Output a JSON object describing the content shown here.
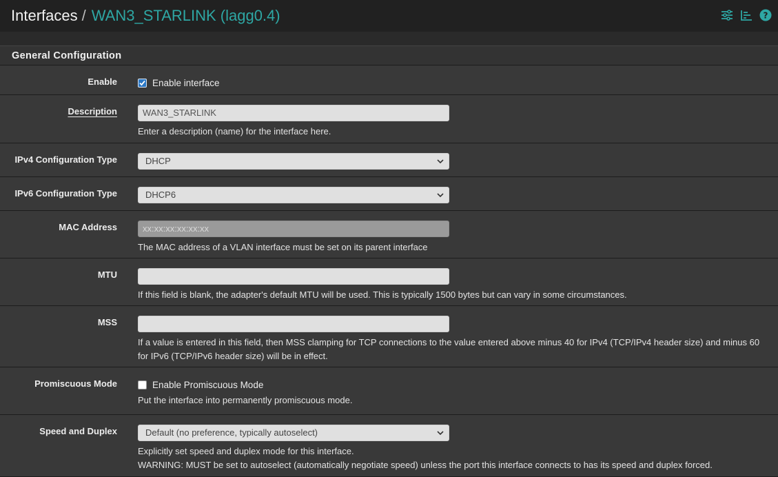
{
  "breadcrumb": {
    "root": "Interfaces",
    "separator": "/",
    "current": "WAN3_STARLINK (lagg0.4)"
  },
  "header_icons": [
    "sliders-icon",
    "list-chart-icon",
    "help-icon"
  ],
  "colors": {
    "accent": "#2ea7a4",
    "checkbox_on": "#2b78c5"
  },
  "panel": {
    "title": "General Configuration"
  },
  "fields": {
    "enable": {
      "label": "Enable",
      "checkbox_label": "Enable interface",
      "checked": true
    },
    "description": {
      "label": "Description",
      "value": "WAN3_STARLINK",
      "help": "Enter a description (name) for the interface here."
    },
    "ipv4": {
      "label": "IPv4 Configuration Type",
      "selected": "DHCP"
    },
    "ipv6": {
      "label": "IPv6 Configuration Type",
      "selected": "DHCP6"
    },
    "mac": {
      "label": "MAC Address",
      "placeholder": "xx:xx:xx:xx:xx:xx",
      "help": "The MAC address of a VLAN interface must be set on its parent interface"
    },
    "mtu": {
      "label": "MTU",
      "value": "",
      "help": "If this field is blank, the adapter's default MTU will be used. This is typically 1500 bytes but can vary in some circumstances."
    },
    "mss": {
      "label": "MSS",
      "value": "",
      "help": "If a value is entered in this field, then MSS clamping for TCP connections to the value entered above minus 40 for IPv4 (TCP/IPv4 header size) and minus 60 for IPv6 (TCP/IPv6 header size) will be in effect."
    },
    "promiscuous": {
      "label": "Promiscuous Mode",
      "checkbox_label": "Enable Promiscuous Mode",
      "checked": false,
      "help": "Put the interface into permanently promiscuous mode."
    },
    "speed": {
      "label": "Speed and Duplex",
      "selected": "Default (no preference, typically autoselect)",
      "help": "Explicitly set speed and duplex mode for this interface.",
      "warning": "WARNING: MUST be set to autoselect (automatically negotiate speed) unless the port this interface connects to has its speed and duplex forced."
    }
  }
}
